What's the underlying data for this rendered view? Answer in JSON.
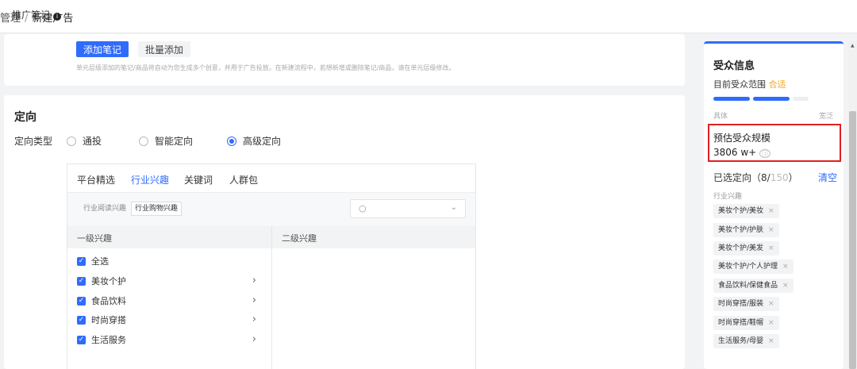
{
  "breadcrumb": {
    "parent": "管理",
    "sep": "/",
    "current": "新建广告"
  },
  "note": {
    "label": "推广笔记",
    "info_icon": "info-icon",
    "add_label": "添加笔记",
    "batch_label": "批量添加",
    "hint": "单元层级添加的笔记/商品将自动为您生成多个创意，并用于广告投放。在新建流程中，若想新增或删除笔记/商品，请在单元层级修改。"
  },
  "targeting": {
    "title": "定向",
    "type_label": "定向类型",
    "options": [
      {
        "label": "通投",
        "selected": false
      },
      {
        "label": "智能定向",
        "selected": false
      },
      {
        "label": "高级定向",
        "selected": true
      }
    ],
    "tabs": [
      {
        "label": "平台精选",
        "active": false
      },
      {
        "label": "行业兴趣",
        "active": true
      },
      {
        "label": "关键词",
        "active": false
      },
      {
        "label": "人群包",
        "active": false
      }
    ],
    "segments": [
      {
        "label": "行业阅读兴趣",
        "active": false
      },
      {
        "label": "行业购物兴趣",
        "active": true
      }
    ],
    "search_icon": "search-icon",
    "columns": {
      "level1": "一级兴趣",
      "level2": "二级兴趣"
    },
    "rows": [
      {
        "label": "全选",
        "checked": true,
        "has_arrow": false
      },
      {
        "label": "美妆个护",
        "checked": true,
        "has_arrow": true
      },
      {
        "label": "食品饮料",
        "checked": true,
        "has_arrow": true
      },
      {
        "label": "时尚穿搭",
        "checked": true,
        "has_arrow": true
      },
      {
        "label": "生活服务",
        "checked": true,
        "has_arrow": true
      }
    ]
  },
  "audience": {
    "title": "受众信息",
    "range_label": "目前受众范围",
    "range_value": "合适",
    "scale_left": "具体",
    "scale_right": "宽泛",
    "estimate_label": "预估受众规模",
    "estimate_value": "3806 w+",
    "estimate_icon": "ⓘ",
    "selected_prefix": "已选定向（8/",
    "selected_max": "150",
    "selected_suffix": "）",
    "clear_label": "清空",
    "group_label": "行业兴趣",
    "chips": [
      "美妆个护/美妆",
      "美妆个护/护肤",
      "美妆个护/美发",
      "美妆个护/个人护理",
      "食品饮料/保健食品",
      "时尚穿搭/服装",
      "时尚穿搭/鞋帽",
      "生活服务/母婴"
    ],
    "chip_remove": "×"
  },
  "colors": {
    "accent": "#2f6bff",
    "highlight_border": "#e02020",
    "fit": "#f5a623"
  }
}
